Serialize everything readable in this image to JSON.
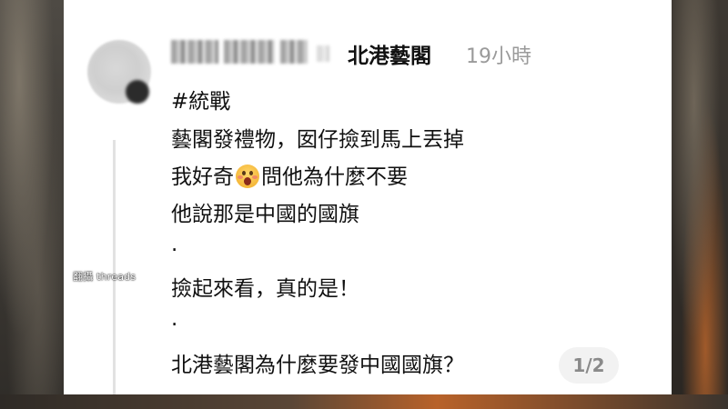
{
  "post": {
    "author": "北港藝閣",
    "time": "19小時",
    "lines": [
      "#統戰",
      "藝閣發禮物，囡仔撿到馬上丟掉",
      "我好奇",
      "問他為什麼不要",
      "他說那是中國的國旗",
      ".",
      "撿起來看，真的是！",
      ".",
      "北港藝閣為什麼要發中國國旗？"
    ]
  },
  "emoji_icon": "astonished-face-icon",
  "pager": {
    "label": "1/2"
  },
  "watermark": "翻攝 threads"
}
